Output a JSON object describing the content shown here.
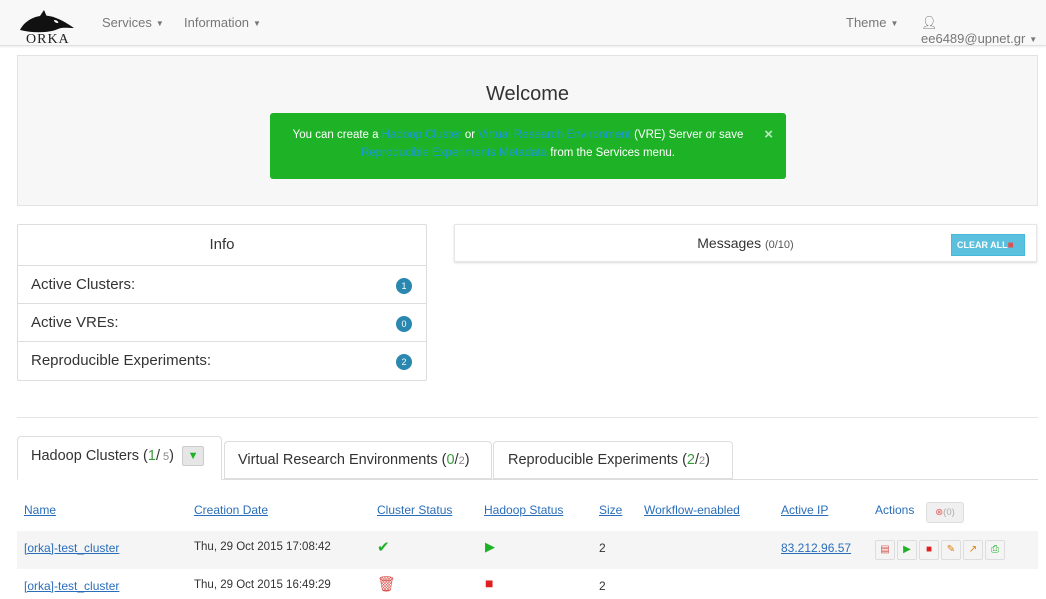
{
  "nav": {
    "logo_text": "ORKA",
    "services": "Services",
    "information": "Information",
    "theme": "Theme",
    "user": "ee6489@upnet.gr"
  },
  "welcome": {
    "title": "Welcome",
    "alert_text_1": "You can create a",
    "alert_link_1": "Hadoop Cluster",
    "alert_text_2": "or",
    "alert_link_2": "Virtual Research Environment",
    "alert_text_3": "(VRE) Server or save",
    "alert_link_3": "Reproducible Experiments Metadata",
    "alert_text_4": "from the Services menu.",
    "close": "×"
  },
  "info": {
    "title": "Info",
    "rows": [
      {
        "label": "Active Clusters:",
        "count": "1"
      },
      {
        "label": "Active VREs:",
        "count": "0"
      },
      {
        "label": "Reproducible Experiments:",
        "count": "2"
      }
    ]
  },
  "messages": {
    "title": "Messages",
    "count": "(0/10)",
    "clear_all": "CLEAR ALL"
  },
  "tabs": [
    {
      "label": "Hadoop Clusters",
      "num": "1",
      "den": " 5"
    },
    {
      "label": "Virtual Research Environments",
      "num": "0",
      "den": "2"
    },
    {
      "label": "Reproducible Experiments",
      "num": "2",
      "den": "2"
    }
  ],
  "table": {
    "headers": {
      "name": "Name",
      "creation_date": "Creation Date",
      "cluster_status": "Cluster Status",
      "hadoop_status": "Hadoop Status",
      "size": "Size",
      "workflow": "Workflow-enabled",
      "active_ip": "Active IP",
      "actions": "Actions",
      "stop_count": "(0)"
    },
    "rows": [
      {
        "name": "[orka]-test_cluster",
        "date": "Thu, 29 Oct 2015 17:08:42",
        "cluster_status": "check-icon",
        "hadoop_status": "play-icon",
        "size": "2",
        "ip": "83.212.96.57"
      },
      {
        "name": "[orka]-test_cluster",
        "date": "Thu, 29 Oct 2015 16:49:29",
        "cluster_status": "trash-icon",
        "hadoop_status": "stop-icon",
        "size": "2",
        "ip": ""
      }
    ]
  },
  "colors": {
    "alert_green": "#1eb327",
    "badge_blue": "#2a87b0",
    "link_blue": "#2a6ebb",
    "clear_btn": "#5bc0de"
  }
}
